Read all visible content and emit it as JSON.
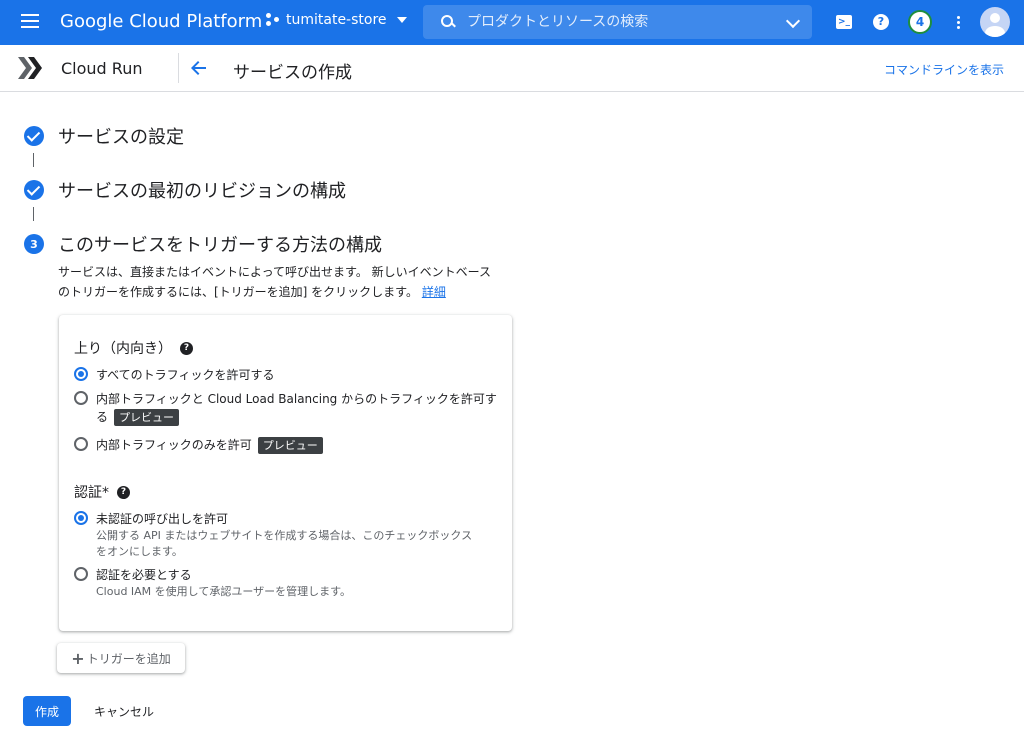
{
  "topbar": {
    "brand": "Google Cloud Platform",
    "project_name": "tumitate-store",
    "search_placeholder": "プロダクトとリソースの検索",
    "notification_count": "4",
    "accent_color": "#1a73e8"
  },
  "subheader": {
    "product_name": "Cloud Run",
    "page_title": "サービスの作成",
    "command_line_link": "コマンドラインを表示"
  },
  "steps": [
    {
      "status": "done",
      "title": "サービスの設定"
    },
    {
      "status": "done",
      "title": "サービスの最初のリビジョンの構成"
    },
    {
      "status": "current",
      "number": "3",
      "title": "このサービスをトリガーする方法の構成"
    }
  ],
  "description": {
    "line1": "サービスは、直接またはイベントによって呼び出せます。 新しいイベントベース",
    "line2": "のトリガーを作成するには、[トリガーを追加] をクリックします。",
    "link": "詳細"
  },
  "ingress": {
    "label": "上り（内向き）",
    "options": [
      {
        "label": "すべてのトラフィックを許可する",
        "checked": true
      },
      {
        "label_line1": "内部トラフィックと Cloud Load Balancing からのトラフィックを許可す",
        "label_line2": "る",
        "badge": "プレビュー",
        "checked": false
      },
      {
        "label": "内部トラフィックのみを許可",
        "badge": "プレビュー",
        "checked": false
      }
    ]
  },
  "auth": {
    "label": "認証*",
    "options": [
      {
        "label": "未認証の呼び出しを許可",
        "sub_line1": "公開する API またはウェブサイトを作成する場合は、このチェックボックス",
        "sub_line2": "をオンにします。",
        "checked": true
      },
      {
        "label": "認証を必要とする",
        "sub_line1": "Cloud IAM を使用して承認ユーザーを管理します。",
        "checked": false
      }
    ]
  },
  "actions": {
    "add_trigger": "トリガーを追加",
    "create": "作成",
    "cancel": "キャンセル"
  },
  "icons": {
    "menu": "hamburger-menu-icon",
    "search": "search-icon",
    "shell": "cloud-shell-icon",
    "help": "help-icon",
    "more": "more-vert-icon",
    "back": "back-arrow-icon"
  }
}
